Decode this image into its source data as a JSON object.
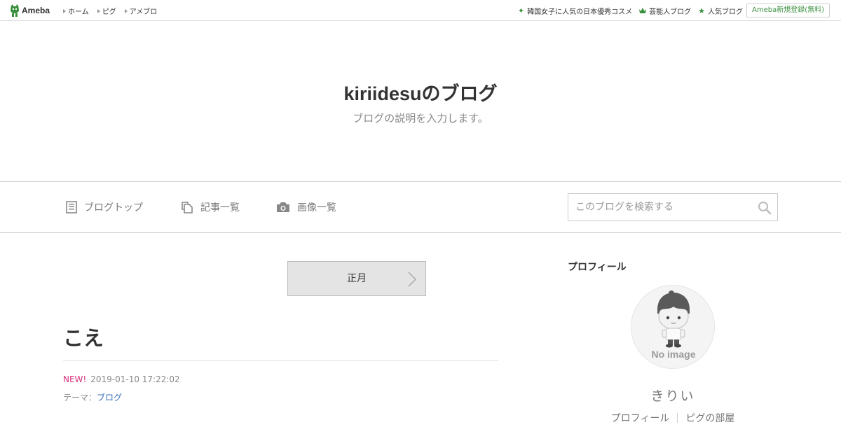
{
  "header": {
    "logo_text": "Ameba",
    "nav": [
      {
        "label": "ホーム"
      },
      {
        "label": "ピグ"
      },
      {
        "label": "アメブロ"
      }
    ],
    "right_links": [
      {
        "label": "韓国女子に人気の日本優秀コスメ",
        "icon": "sparkle-icon"
      },
      {
        "label": "芸能人ブログ",
        "icon": "crown-icon"
      },
      {
        "label": "人気ブログ",
        "icon": "star-icon"
      }
    ],
    "register_label": "Ameba新規登録(無料)",
    "accent_color": "#3a8f3e"
  },
  "blog": {
    "title": "kiriidesuのブログ",
    "description": "ブログの説明を入力します。"
  },
  "nav": {
    "items": [
      {
        "label": "ブログトップ",
        "icon": "document-icon"
      },
      {
        "label": "記事一覧",
        "icon": "copy-icon"
      },
      {
        "label": "画像一覧",
        "icon": "camera-icon"
      }
    ],
    "search_placeholder": "このブログを検索する"
  },
  "main": {
    "theme_button_label": "正月",
    "entry": {
      "title": "こえ",
      "new_label": "NEW!",
      "date": "2019-01-10 17:22:02",
      "theme_prefix": "テーマ：",
      "theme_link": "ブログ"
    }
  },
  "sidebar": {
    "heading": "プロフィール",
    "avatar_text": "No image",
    "name": "きりい",
    "links": [
      {
        "label": "プロフィール"
      },
      {
        "label": "ピグの部屋"
      }
    ]
  }
}
